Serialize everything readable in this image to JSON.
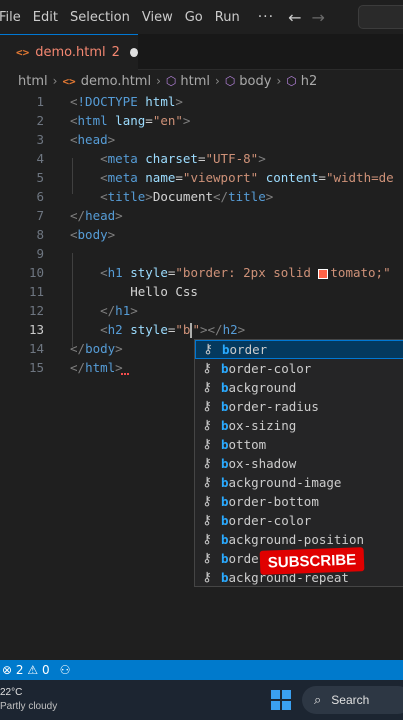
{
  "menubar": {
    "items": [
      "File",
      "Edit",
      "Selection",
      "View",
      "Go",
      "Run"
    ],
    "more": "···",
    "back": "←",
    "forward": "→"
  },
  "tab": {
    "icon": "<>",
    "label": "demo.html",
    "problems": "2"
  },
  "breadcrumb": {
    "items": [
      "html",
      "demo.html",
      "html",
      "body",
      "h2"
    ],
    "sep": "›"
  },
  "editor": {
    "active_line": 13,
    "lines": [
      {
        "n": "1",
        "html": "<span class='bracket'>&lt;</span><span class='tag'>!DOCTYPE</span> <span class='attr'>html</span><span class='bracket'>&gt;</span>"
      },
      {
        "n": "2",
        "html": "<span class='bracket'>&lt;</span><span class='tag'>html</span> <span class='attr'>lang</span>=<span class='str'>\"en\"</span><span class='bracket'>&gt;</span>"
      },
      {
        "n": "3",
        "html": "<span class='bracket'>&lt;</span><span class='tag'>head</span><span class='bracket'>&gt;</span>"
      },
      {
        "n": "4",
        "html": "    <span class='bracket'>&lt;</span><span class='tag'>meta</span> <span class='attr'>charset</span>=<span class='str'>\"UTF-8\"</span><span class='bracket'>&gt;</span>"
      },
      {
        "n": "5",
        "html": "    <span class='bracket'>&lt;</span><span class='tag'>meta</span> <span class='attr'>name</span>=<span class='str'>\"viewport\"</span> <span class='attr'>content</span>=<span class='str'>\"width=de</span>"
      },
      {
        "n": "6",
        "html": "    <span class='bracket'>&lt;</span><span class='tag'>title</span><span class='bracket'>&gt;</span><span class='txt'>Document</span><span class='bracket'>&lt;/</span><span class='tag'>title</span><span class='bracket'>&gt;</span>"
      },
      {
        "n": "7",
        "html": "<span class='bracket'>&lt;/</span><span class='tag'>head</span><span class='bracket'>&gt;</span>"
      },
      {
        "n": "8",
        "html": "<span class='bracket'>&lt;</span><span class='tag'>body</span><span class='bracket'>&gt;</span>"
      },
      {
        "n": "9",
        "html": ""
      },
      {
        "n": "10",
        "html": "    <span class='bracket'>&lt;</span><span class='tag'>h1</span> <span class='attr'>style</span>=<span class='str'>\"border: 2px solid </span><span class='swatch'></span><span class='str'>tomato;\"</span>"
      },
      {
        "n": "11",
        "html": "        <span class='txt'>Hello Css</span>"
      },
      {
        "n": "12",
        "html": "    <span class='bracket'>&lt;/</span><span class='tag'>h1</span><span class='bracket'>&gt;</span>"
      },
      {
        "n": "13",
        "html": "    <span class='bracket'>&lt;</span><span class='tag'>h2</span> <span class='attr'>style</span>=<span class='str'>\"b</span><span class='cursor'></span><span class='str'>\"</span><span class='bracket'>&gt;&lt;/</span><span class='tag'>h2</span><span class='bracket'>&gt;</span>"
      },
      {
        "n": "14",
        "html": "<span class='bracket'>&lt;/</span><span class='tag'>body</span><span class='bracket'>&gt;</span>"
      },
      {
        "n": "15",
        "html": "<span class='bracket'>&lt;/</span><span class='tag'>html</span><span class='bracket'>&gt;</span>"
      }
    ]
  },
  "suggestions": {
    "typed": "b",
    "icon": "wrench-icon",
    "items": [
      "border",
      "border-color",
      "background",
      "border-radius",
      "box-sizing",
      "bottom",
      "box-shadow",
      "background-image",
      "border-bottom",
      "border-color",
      "background-position",
      "border",
      "background-repeat"
    ],
    "selected_index": 0
  },
  "overlay": {
    "subscribe": "SUBSCRIBE"
  },
  "statusbar": {
    "errors": "2",
    "warnings": "0"
  },
  "taskbar": {
    "temperature": "22°C",
    "weather": "Partly cloudy",
    "search": "Search"
  },
  "colors": {
    "accent": "#007acc",
    "selection": "#04395e",
    "error": "#f48771",
    "subscribe": "#e00000"
  }
}
